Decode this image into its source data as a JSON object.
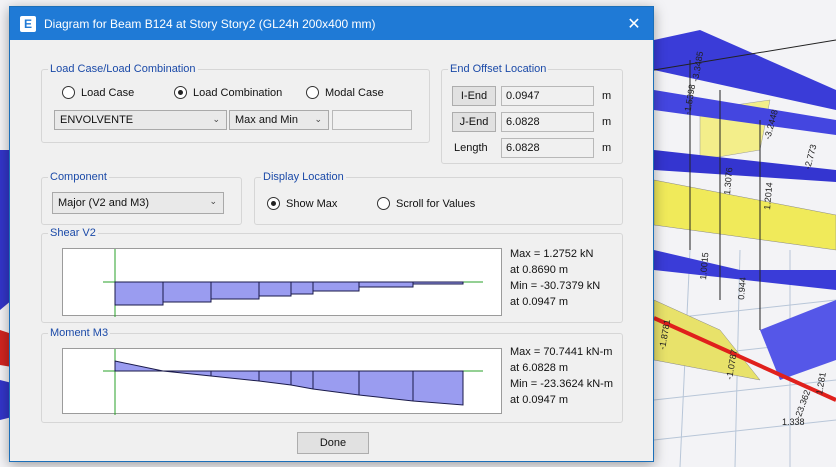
{
  "dialog": {
    "title": "Diagram for Beam B124 at Story Story2 (GL24h 200x400 mm)",
    "app_icon_letter": "E",
    "close_glyph": "✕"
  },
  "load_group": {
    "legend": "Load Case/Load Combination",
    "radio_load_case": "Load Case",
    "radio_load_combination": "Load Combination",
    "radio_modal_case": "Modal Case",
    "selected_radio": "Load Combination",
    "combo_value": "ENVOLVENTE",
    "mode_value": "Max and Min",
    "extra_value": ""
  },
  "end_offset": {
    "legend": "End Offset Location",
    "iend_label": "I-End",
    "iend_value": "0.0947",
    "jend_label": "J-End",
    "jend_value": "6.0828",
    "length_label": "Length",
    "length_value": "6.0828",
    "unit": "m"
  },
  "component": {
    "legend": "Component",
    "value": "Major (V2 and M3)"
  },
  "display_location": {
    "legend": "Display Location",
    "show_max": "Show Max",
    "scroll_values": "Scroll for Values",
    "selected": "Show Max"
  },
  "shear": {
    "legend": "Shear V2",
    "max_line": "Max = 1.2752 kN",
    "max_at": "at 0.8690 m",
    "min_line": "Min = -30.7379 kN",
    "min_at": "at 0.0947 m"
  },
  "moment": {
    "legend": "Moment M3",
    "max_line": "Max = 70.7441 kN-m",
    "max_at": "at 6.0828 m",
    "min_line": "Min = -23.3624 kN-m",
    "min_at": "at 0.0947 m"
  },
  "footer": {
    "done_label": "Done"
  },
  "background_labels": [
    "-3.3485",
    "-1.5398",
    "-3.2448",
    "-2.773",
    "1.3076",
    "1.2014",
    "1.0015",
    "0.944",
    "-1.8781",
    "-1.0787",
    "-23.362",
    "1.338",
    "1.281"
  ],
  "colors": {
    "accent": "#1f7ad6",
    "diagram_fill": "#9a9cf0",
    "diagram_stroke": "#1a1a4a",
    "axis_line": "#2aa02a",
    "legend_text": "#1b4aa8"
  }
}
